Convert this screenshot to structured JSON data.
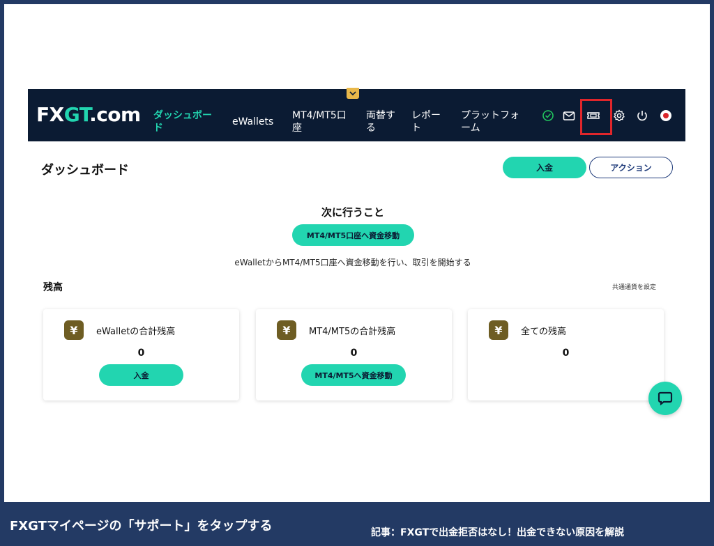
{
  "header": {
    "logo_main": "FX",
    "logo_accent": "GT",
    "logo_suffix": ".com",
    "nav": [
      {
        "label_1": "ダッシュボー",
        "label_2": "ド"
      },
      {
        "label_1": "eWallets",
        "label_2": ""
      },
      {
        "label_1": "MT4/MT5口",
        "label_2": "座"
      },
      {
        "label_1": "両替す",
        "label_2": "る"
      },
      {
        "label_1": "レポー",
        "label_2": "ト"
      },
      {
        "label_1": "プラットフォ",
        "label_2": "ーム"
      }
    ],
    "icons": [
      "check-circle-icon",
      "mail-icon",
      "ticket-icon",
      "gear-icon",
      "power-icon",
      "flag-icon"
    ],
    "accent_color": "#22d5b0",
    "highlight_color": "#e0262b"
  },
  "page": {
    "title": "ダッシュボード",
    "deposit_button": "入金",
    "action_button": "アクション"
  },
  "next": {
    "title": "次に行うこと",
    "button": "MT4/MT5口座へ資金移動",
    "description": "eWalletからMT4/MT5口座へ資金移動を行い、取引を開始する"
  },
  "balance": {
    "title": "残高",
    "currency_link": "共通通貨を設定",
    "cards": [
      {
        "label": "eWalletの合計残高",
        "value": "0",
        "button": "入金"
      },
      {
        "label": "MT4/MT5の合計残高",
        "value": "0",
        "button": "MT4/MT5へ資金移動"
      },
      {
        "label": "全ての残高",
        "value": "0"
      }
    ],
    "currency_symbol": "¥"
  },
  "footer": {
    "caption": "FXGTマイページの「サポート」をタップする",
    "article": "記事：FXGTで出金拒否はなし！出金できない原因を解説"
  }
}
